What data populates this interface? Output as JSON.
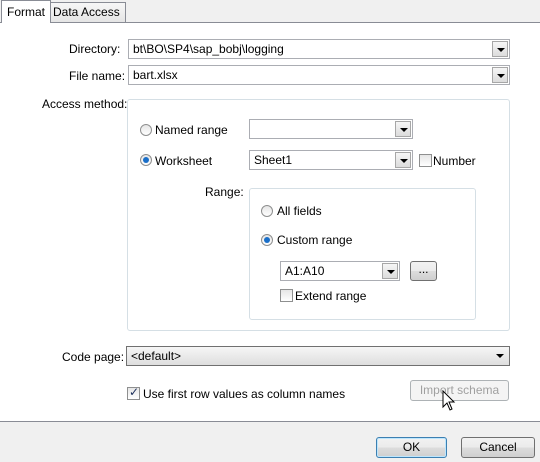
{
  "tabs": [
    {
      "label": "Format",
      "active": true
    },
    {
      "label": "Data Access",
      "active": false
    }
  ],
  "directory": {
    "label": "Directory:",
    "value": "bt\\BO\\SP4\\sap_bobj\\logging"
  },
  "file_name": {
    "label": "File name:",
    "value": "bart.xlsx"
  },
  "access_method": {
    "label": "Access method:",
    "named_range": {
      "label": "Named range",
      "selected": false,
      "value": ""
    },
    "worksheet": {
      "label": "Worksheet",
      "selected": true,
      "value": "Sheet1"
    },
    "number": {
      "label": "Number",
      "checked": false
    },
    "range": {
      "label": "Range:",
      "all_fields": {
        "label": "All fields",
        "selected": false
      },
      "custom_range": {
        "label": "Custom range",
        "selected": true,
        "value": "A1:A10",
        "browse_label": "..."
      },
      "extend_range": {
        "label": "Extend range",
        "checked": false
      }
    }
  },
  "code_page": {
    "label": "Code page:",
    "value": "<default>"
  },
  "first_row": {
    "label": "Use first row values as column names",
    "checked": true
  },
  "import_schema": {
    "label": "Import schema",
    "enabled": false
  },
  "footer": {
    "ok_label": "OK",
    "cancel_label": "Cancel"
  },
  "colors": {
    "selection_accent": "#1a6fc9",
    "default_button_border": "#3c7fb1"
  }
}
